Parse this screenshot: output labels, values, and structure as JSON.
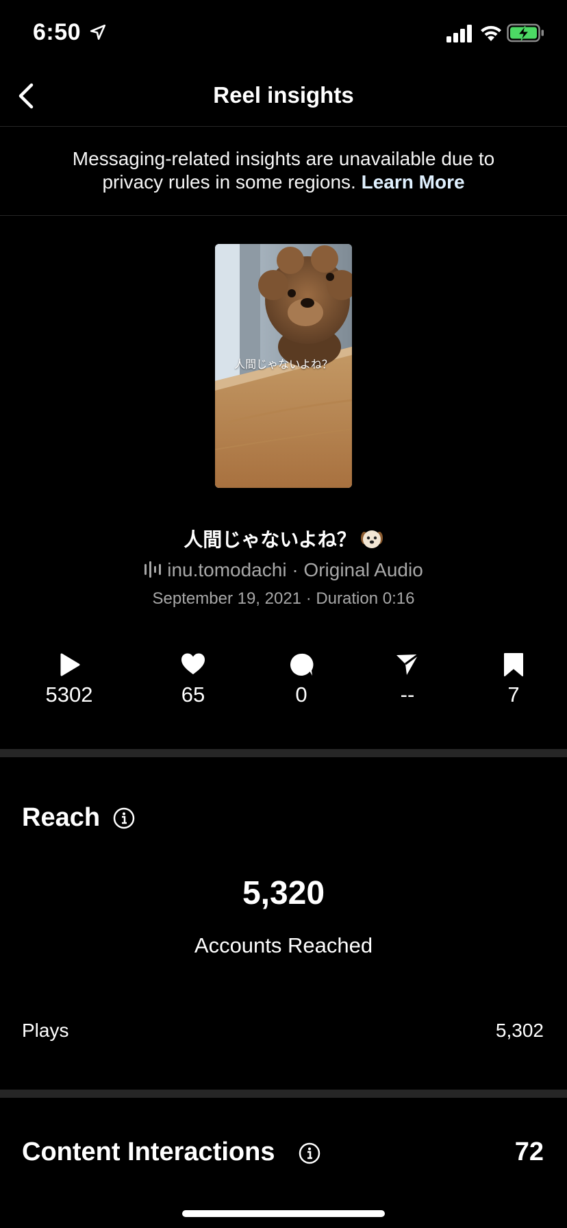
{
  "status_bar": {
    "time": "6:50"
  },
  "nav": {
    "title": "Reel insights"
  },
  "notice": {
    "text": "Messaging-related insights are unavailable due to privacy rules in some regions.",
    "link": "Learn More"
  },
  "reel": {
    "thumbnail_caption": "人間じゃないよね？",
    "title": "人間じゃないよね？",
    "title_emoji": "dog-face-emoji",
    "audio": "inu.tomodachi · Original Audio",
    "meta": "September 19, 2021 · Duration 0:16"
  },
  "stats": {
    "plays": "5302",
    "likes": "65",
    "comments": "0",
    "shares": "--",
    "saves": "7"
  },
  "reach": {
    "title": "Reach",
    "value": "5,320",
    "label": "Accounts Reached",
    "plays_label": "Plays",
    "plays_value": "5,302"
  },
  "content_interactions": {
    "title": "Content Interactions",
    "value": "72"
  },
  "colors": {
    "background": "#000000",
    "divider": "#262626",
    "secondary_text": "#a8a8a8",
    "battery_green": "#4cd964"
  }
}
